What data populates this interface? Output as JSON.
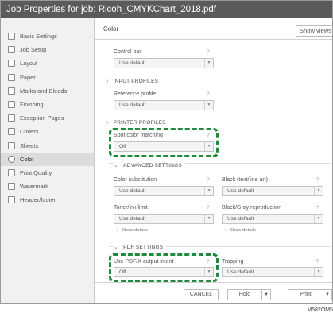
{
  "window": {
    "title": "Job Properties for job: Ricoh_CMYKChart_2018.pdf"
  },
  "sidebar": {
    "items": [
      {
        "label": "Basic Settings",
        "icon": "basic-settings-icon"
      },
      {
        "label": "Job Setup",
        "icon": "job-setup-icon"
      },
      {
        "label": "Layout",
        "icon": "layout-icon"
      },
      {
        "label": "Paper",
        "icon": "paper-icon"
      },
      {
        "label": "Marks and Bleeds",
        "icon": "marks-and-bleeds-icon"
      },
      {
        "label": "Finishing",
        "icon": "finishing-icon"
      },
      {
        "label": "Exception Pages",
        "icon": "exception-pages-icon"
      },
      {
        "label": "Covers",
        "icon": "covers-icon"
      },
      {
        "label": "Sheets",
        "icon": "sheets-icon"
      },
      {
        "label": "Color",
        "icon": "color-icon",
        "active": true
      },
      {
        "label": "Print Quality",
        "icon": "print-quality-icon"
      },
      {
        "label": "Watermark",
        "icon": "watermark-icon"
      },
      {
        "label": "Header/footer",
        "icon": "header-footer-icon"
      }
    ]
  },
  "main": {
    "title": "Color",
    "show_views": "Show views",
    "help": "?",
    "control_bar": {
      "label": "Control bar",
      "value": "Use default"
    },
    "input_profiles": {
      "heading": "INPUT PROFILES",
      "reference_profile": {
        "label": "Reference profile",
        "value": "Use default"
      }
    },
    "printer_profiles": {
      "heading": "PRINTER PROFILES",
      "spot_color_matching": {
        "label": "Spot color matching",
        "value": "Off"
      }
    },
    "advanced_settings": {
      "heading": "ADVANCED SETTINGS",
      "color_substitution": {
        "label": "Color substitution",
        "value": "Use default"
      },
      "black_text_line_art": {
        "label": "Black (text/line art)",
        "value": "Use default"
      },
      "toner_ink_limit": {
        "label": "Toner/ink limit",
        "value": "Use default"
      },
      "black_gray_reproduction": {
        "label": "Black/Gray reproduction",
        "value": "Use default"
      },
      "show_details": "Show details"
    },
    "pdf_settings": {
      "heading": "PDF SETTINGS",
      "use_pdfx_output_intent": {
        "label": "Use PDF/X output intent",
        "value": "Off"
      },
      "trapping": {
        "label": "Trapping",
        "value": "Use default"
      }
    }
  },
  "footer": {
    "cancel": "CANCEL",
    "hold": "Hold",
    "print": "Print"
  },
  "figure_ref": "M582OM5",
  "colors": {
    "titlebar": "#5b5b5b",
    "highlight": "#1f8a3c"
  }
}
